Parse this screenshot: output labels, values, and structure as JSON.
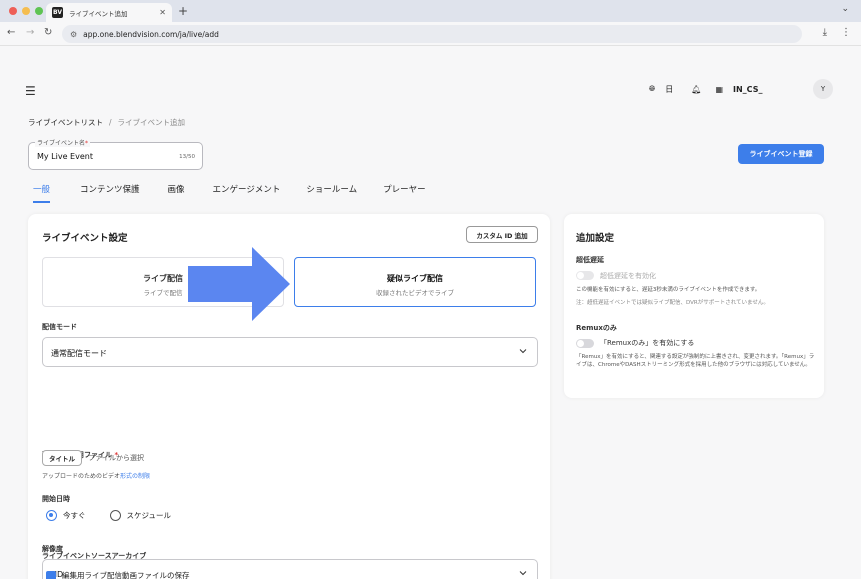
{
  "browser": {
    "tab_title": "ライブイベント追加",
    "tab_favicon": "BV",
    "url": "app.one.blendvision.com/ja/live/add"
  },
  "header": {
    "language": "日",
    "org_name": "IN_CS_",
    "avatar_initial": "Y"
  },
  "breadcrumb": {
    "root": "ライブイベントリスト",
    "separator": "/",
    "current": "ライブイベント追加"
  },
  "event_name": {
    "label": "ライブイベント名",
    "required_mark": "*",
    "value": "My Live Event",
    "counter": "13/50"
  },
  "register_button": "ライブイベント登録",
  "tabs": [
    {
      "label": "一般",
      "active": true
    },
    {
      "label": "コンテンツ保護",
      "active": false
    },
    {
      "label": "画像",
      "active": false
    },
    {
      "label": "エンゲージメント",
      "active": false
    },
    {
      "label": "ショールーム",
      "active": false
    },
    {
      "label": "プレーヤー",
      "active": false
    }
  ],
  "settings": {
    "title": "ライブイベント設定",
    "custom_id_button": "カスタム ID 追加",
    "option_live": {
      "title": "ライブ配信",
      "subtitle": "ライブで配信"
    },
    "option_pseudo": {
      "title": "疑似ライブ配信",
      "subtitle": "収録されたビデオでライブ"
    },
    "delivery_mode": {
      "label": "配信モード",
      "value": "通常配信モード"
    },
    "pseudo_file": {
      "label": "疑似ライブ用ファイル",
      "required_mark": "*",
      "title_button": "タイトル",
      "select_text": "ファイルから選択",
      "help_prefix": "アップロードのためのビデオ",
      "help_link": "形式の制限"
    },
    "start_time": {
      "label": "開始日時",
      "options": [
        {
          "label": "今すぐ",
          "selected": true
        },
        {
          "label": "スケジュール",
          "selected": false
        }
      ]
    },
    "resolution": {
      "label": "解像度",
      "value": "HD"
    },
    "archive": {
      "label": "ライブイベントソースアーカイブ",
      "checkbox_label": "編集用ライブ配信動画ファイルの保存"
    }
  },
  "additional": {
    "title": "追加設定",
    "low_latency": {
      "label": "超低遅延",
      "toggle_label": "超低遅延を有効化",
      "description": "この機能を有効にすると、遅延3秒未満のライブイベントを作成できます。",
      "note": "注：超低遅延イベントでは疑似ライブ配信、DVRがサポートされていません。"
    },
    "remux": {
      "label": "Remuxのみ",
      "toggle_label": "「Remuxのみ」を有効にする",
      "description": "「Remux」を有効にすると、関連する設定が強制的に上書きされ、変更されます。「Remux」ライブは、ChromeやDASHストリーミング形式を採用した他のブラウザには対応していません。"
    }
  },
  "colors": {
    "accent": "#3d7eea",
    "arrow": "#5b86f0"
  }
}
